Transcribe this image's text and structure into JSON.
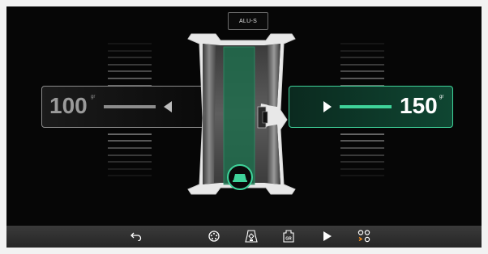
{
  "header": {
    "mode_label": "ALU-S"
  },
  "left_plane": {
    "weight_value": "100",
    "weight_unit": "gr",
    "direction": "left"
  },
  "right_plane": {
    "weight_value": "150",
    "weight_unit": "gr",
    "direction": "right"
  },
  "colors": {
    "accent": "#3fd39a",
    "background": "#060606",
    "toolbar": "#2f2f2f"
  },
  "toolbar": {
    "buttons": [
      {
        "icon": "back-arrow-icon"
      },
      {
        "icon": "wheel-bolt-pattern-icon"
      },
      {
        "icon": "wheel-adhesive-weight-icon"
      },
      {
        "icon": "gr-weight-icon",
        "label": "GR"
      },
      {
        "icon": "play-icon"
      },
      {
        "icon": "menu-dots-icon"
      }
    ]
  }
}
